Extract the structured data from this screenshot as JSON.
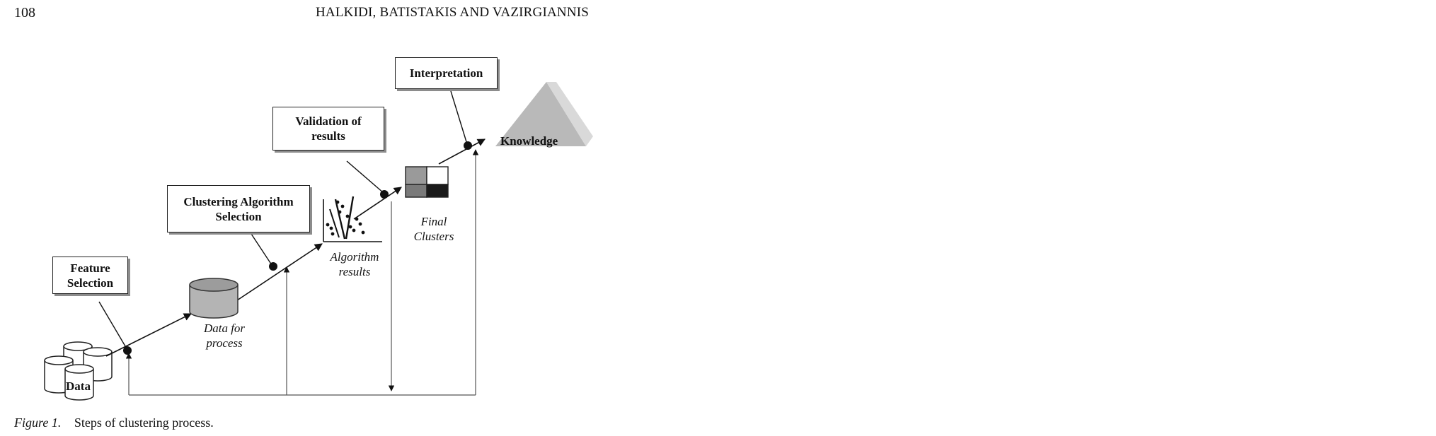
{
  "page": {
    "number": "108",
    "running_head": "HALKIDI, BATISTAKIS AND VAZIRGIANNIS"
  },
  "figure": {
    "boxes": {
      "feature_selection": "Feature\nSelection",
      "clustering_algorithm_selection": "Clustering Algorithm\nSelection",
      "validation_of_results": "Validation of\nresults",
      "interpretation": "Interpretation"
    },
    "labels": {
      "data": "Data",
      "data_for_process": "Data for\nprocess",
      "algorithm_results": "Algorithm\nresults",
      "final_clusters": "Final\nClusters",
      "knowledge": "Knowledge"
    },
    "caption": {
      "label": "Figure 1.",
      "text": "Steps of clustering process."
    }
  }
}
